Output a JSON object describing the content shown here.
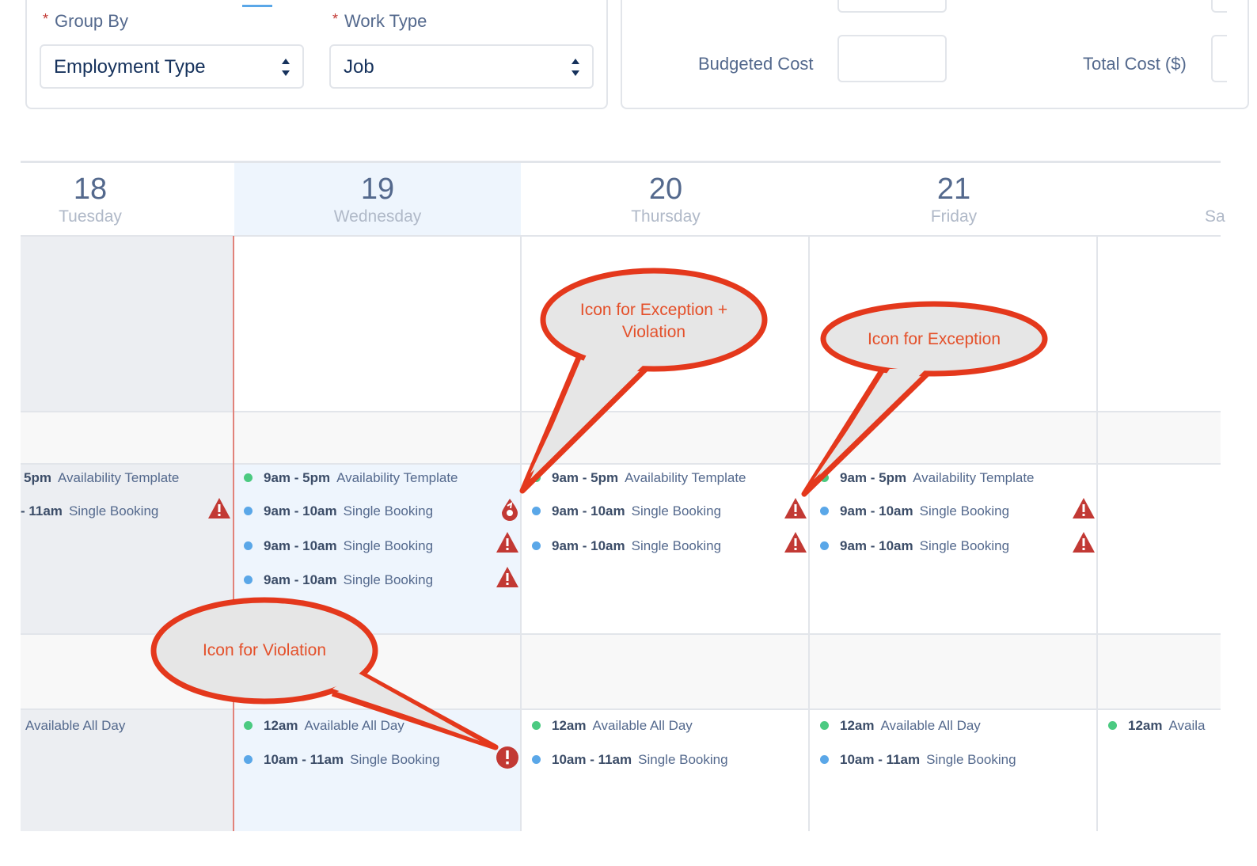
{
  "filters": {
    "group_by": {
      "label": "Group By",
      "value": "Employment Type"
    },
    "work_type": {
      "label": "Work Type",
      "value": "Job"
    },
    "budgeted_cost": {
      "label": "Budgeted Cost",
      "value": ""
    },
    "total_cost": {
      "label": "Total Cost ($)",
      "value": ""
    }
  },
  "days": [
    {
      "num": "18",
      "name": "Tuesday"
    },
    {
      "num": "19",
      "name": "Wednesday"
    },
    {
      "num": "20",
      "name": "Thursday"
    },
    {
      "num": "21",
      "name": "Friday"
    },
    {
      "num": "",
      "name": "Sa"
    }
  ],
  "events": {
    "e1": {
      "time": "5pm",
      "title": "Availability Template"
    },
    "e2": {
      "time": "- 11am",
      "title": "Single Booking"
    },
    "e3": {
      "time": "9am - 5pm",
      "title": "Availability Template"
    },
    "e4": {
      "time": "9am - 10am",
      "title": "Single Booking"
    },
    "e5": {
      "time": "9am - 10am",
      "title": "Single Booking"
    },
    "e6": {
      "time": "9am - 10am",
      "title": "Single Booking"
    },
    "e7": {
      "time": "9am - 5pm",
      "title": "Availability Template"
    },
    "e8": {
      "time": "9am - 10am",
      "title": "Single Booking"
    },
    "e9": {
      "time": "9am - 10am",
      "title": "Single Booking"
    },
    "e10": {
      "time": "9am - 5pm",
      "title": "Availability Template"
    },
    "e11": {
      "time": "9am - 10am",
      "title": "Single Booking"
    },
    "e12": {
      "time": "9am - 10am",
      "title": "Single Booking"
    },
    "e13": {
      "time": "",
      "title": "Available All Day"
    },
    "e14": {
      "time": "12am",
      "title": "Available All Day"
    },
    "e15": {
      "time": "10am - 11am",
      "title": "Single Booking"
    },
    "e16": {
      "time": "12am",
      "title": "Available All Day"
    },
    "e17": {
      "time": "10am - 11am",
      "title": "Single Booking"
    },
    "e18": {
      "time": "12am",
      "title": "Available All Day"
    },
    "e19": {
      "time": "10am - 11am",
      "title": "Single Booking"
    },
    "e20": {
      "time": "12am",
      "title": "Availa"
    }
  },
  "callouts": {
    "exception_violation": "Icon for Exception + Violation",
    "exception": "Icon for Exception",
    "violation": "Icon for Violation"
  },
  "colors": {
    "today_bg": "#eef5fd",
    "weekend_bg": "#eceef2",
    "band_bg": "#f8f8f8",
    "alert_red": "#c23934",
    "callout_red": "#e4381c",
    "callout_fill": "#e6e6e6"
  },
  "icons": {
    "warning": "warning-triangle-icon",
    "exception": "exception-drop-icon",
    "violation": "violation-circle-icon"
  }
}
